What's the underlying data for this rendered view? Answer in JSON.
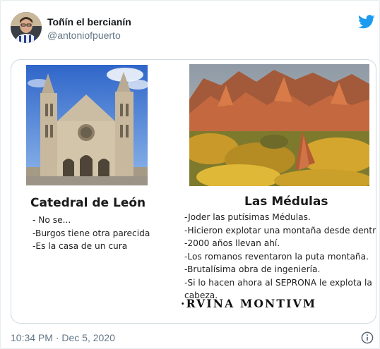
{
  "author": {
    "name": "Toñín el bercianín",
    "handle": "@antoniofpuerto"
  },
  "icons": {
    "brand": "twitter-bird-icon",
    "info": "info-icon"
  },
  "colors": {
    "twitter_blue": "#1d9bf0",
    "muted": "#657786"
  },
  "media": {
    "left": {
      "title": "Catedral de León",
      "lines": [
        "- No se...",
        "-Burgos tiene otra parecida",
        "-Es la casa de un cura"
      ]
    },
    "right": {
      "title": "Las Médulas",
      "lines": [
        "-Joder las putísimas Médulas.",
        "-Hicieron explotar una montaña desde dentro",
        "-2000 años llevan ahí.",
        "-Los romanos reventaron la puta montaña.",
        "-Brutalísima obra de ingeniería.",
        "-Si lo hacen ahora al SEPRONA le explota la",
        "cabeza."
      ],
      "motto": "·RVINA MONTIVM"
    }
  },
  "footer": {
    "timestamp": "10:34 PM · Dec 5, 2020"
  }
}
